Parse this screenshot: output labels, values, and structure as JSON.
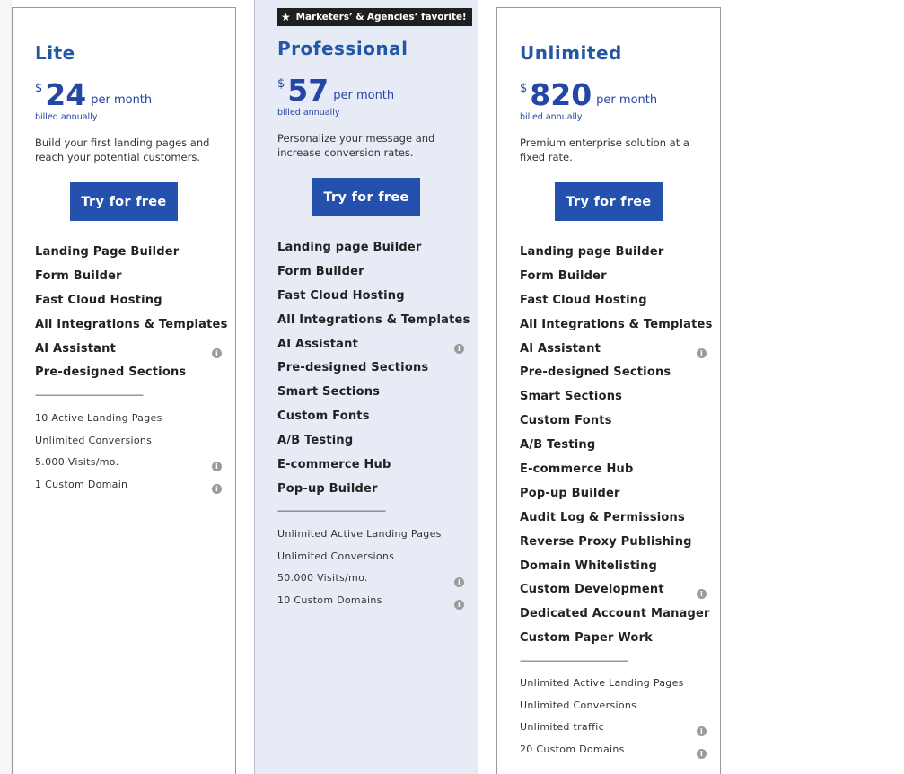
{
  "plans": {
    "lite": {
      "name": "Lite",
      "currency": "$",
      "price": "24",
      "period": "per month",
      "billing": "billed annually",
      "description": "Build your first landing pages and reach your potential customers.",
      "cta": "Try for free",
      "features": [
        "Landing Page Builder",
        "Form Builder",
        "Fast Cloud Hosting",
        "All Integrations & Templates",
        "AI Assistant",
        "Pre-designed Sections"
      ],
      "divider": "————————————",
      "limits": [
        "10 Active Landing Pages",
        "Unlimited Conversions",
        "5.000 Visits/mo.",
        "1 Custom Domain"
      ]
    },
    "professional": {
      "badge": "Marketers’ & Agencies’ favorite!",
      "name": "Professional",
      "currency": "$",
      "price": "57",
      "period": "per month",
      "billing": "billed annually",
      "description": "Personalize your message and increase conversion rates.",
      "cta": "Try for free",
      "features": [
        "Landing page Builder",
        "Form Builder",
        "Fast Cloud Hosting",
        "All Integrations & Templates",
        "AI Assistant",
        "Pre-designed Sections",
        "Smart Sections",
        "Custom Fonts",
        "A/B Testing",
        "E-commerce Hub",
        "Pop-up Builder"
      ],
      "divider": "————————————",
      "limits": [
        "Unlimited Active Landing Pages",
        "Unlimited Conversions",
        "50.000 Visits/mo.",
        "10 Custom Domains"
      ]
    },
    "unlimited": {
      "name": "Unlimited",
      "currency": "$",
      "price": "820",
      "period": "per month",
      "billing": "billed annually",
      "description": "Premium enterprise solution at a fixed rate.",
      "cta": "Try for free",
      "features": [
        "Landing page Builder",
        "Form Builder",
        "Fast Cloud Hosting",
        "All Integrations & Templates",
        "AI Assistant",
        "Pre-designed Sections",
        "Smart Sections",
        "Custom Fonts",
        "A/B Testing",
        "E-commerce Hub",
        "Pop-up Builder",
        "Audit Log & Permissions",
        "Reverse Proxy Publishing",
        "Domain Whitelisting",
        "Custom Development",
        "Dedicated Account Manager",
        "Custom Paper Work"
      ],
      "divider": "————————————",
      "limits": [
        "Unlimited Active Landing Pages",
        "Unlimited Conversions",
        "Unlimited traffic",
        "20 Custom Domains"
      ]
    }
  },
  "info_icon": "i",
  "colors": {
    "accent": "#2451ad",
    "heading": "#2557a7",
    "pro_bg": "#e7ebf6",
    "badge_bg": "#1f1f1f"
  }
}
